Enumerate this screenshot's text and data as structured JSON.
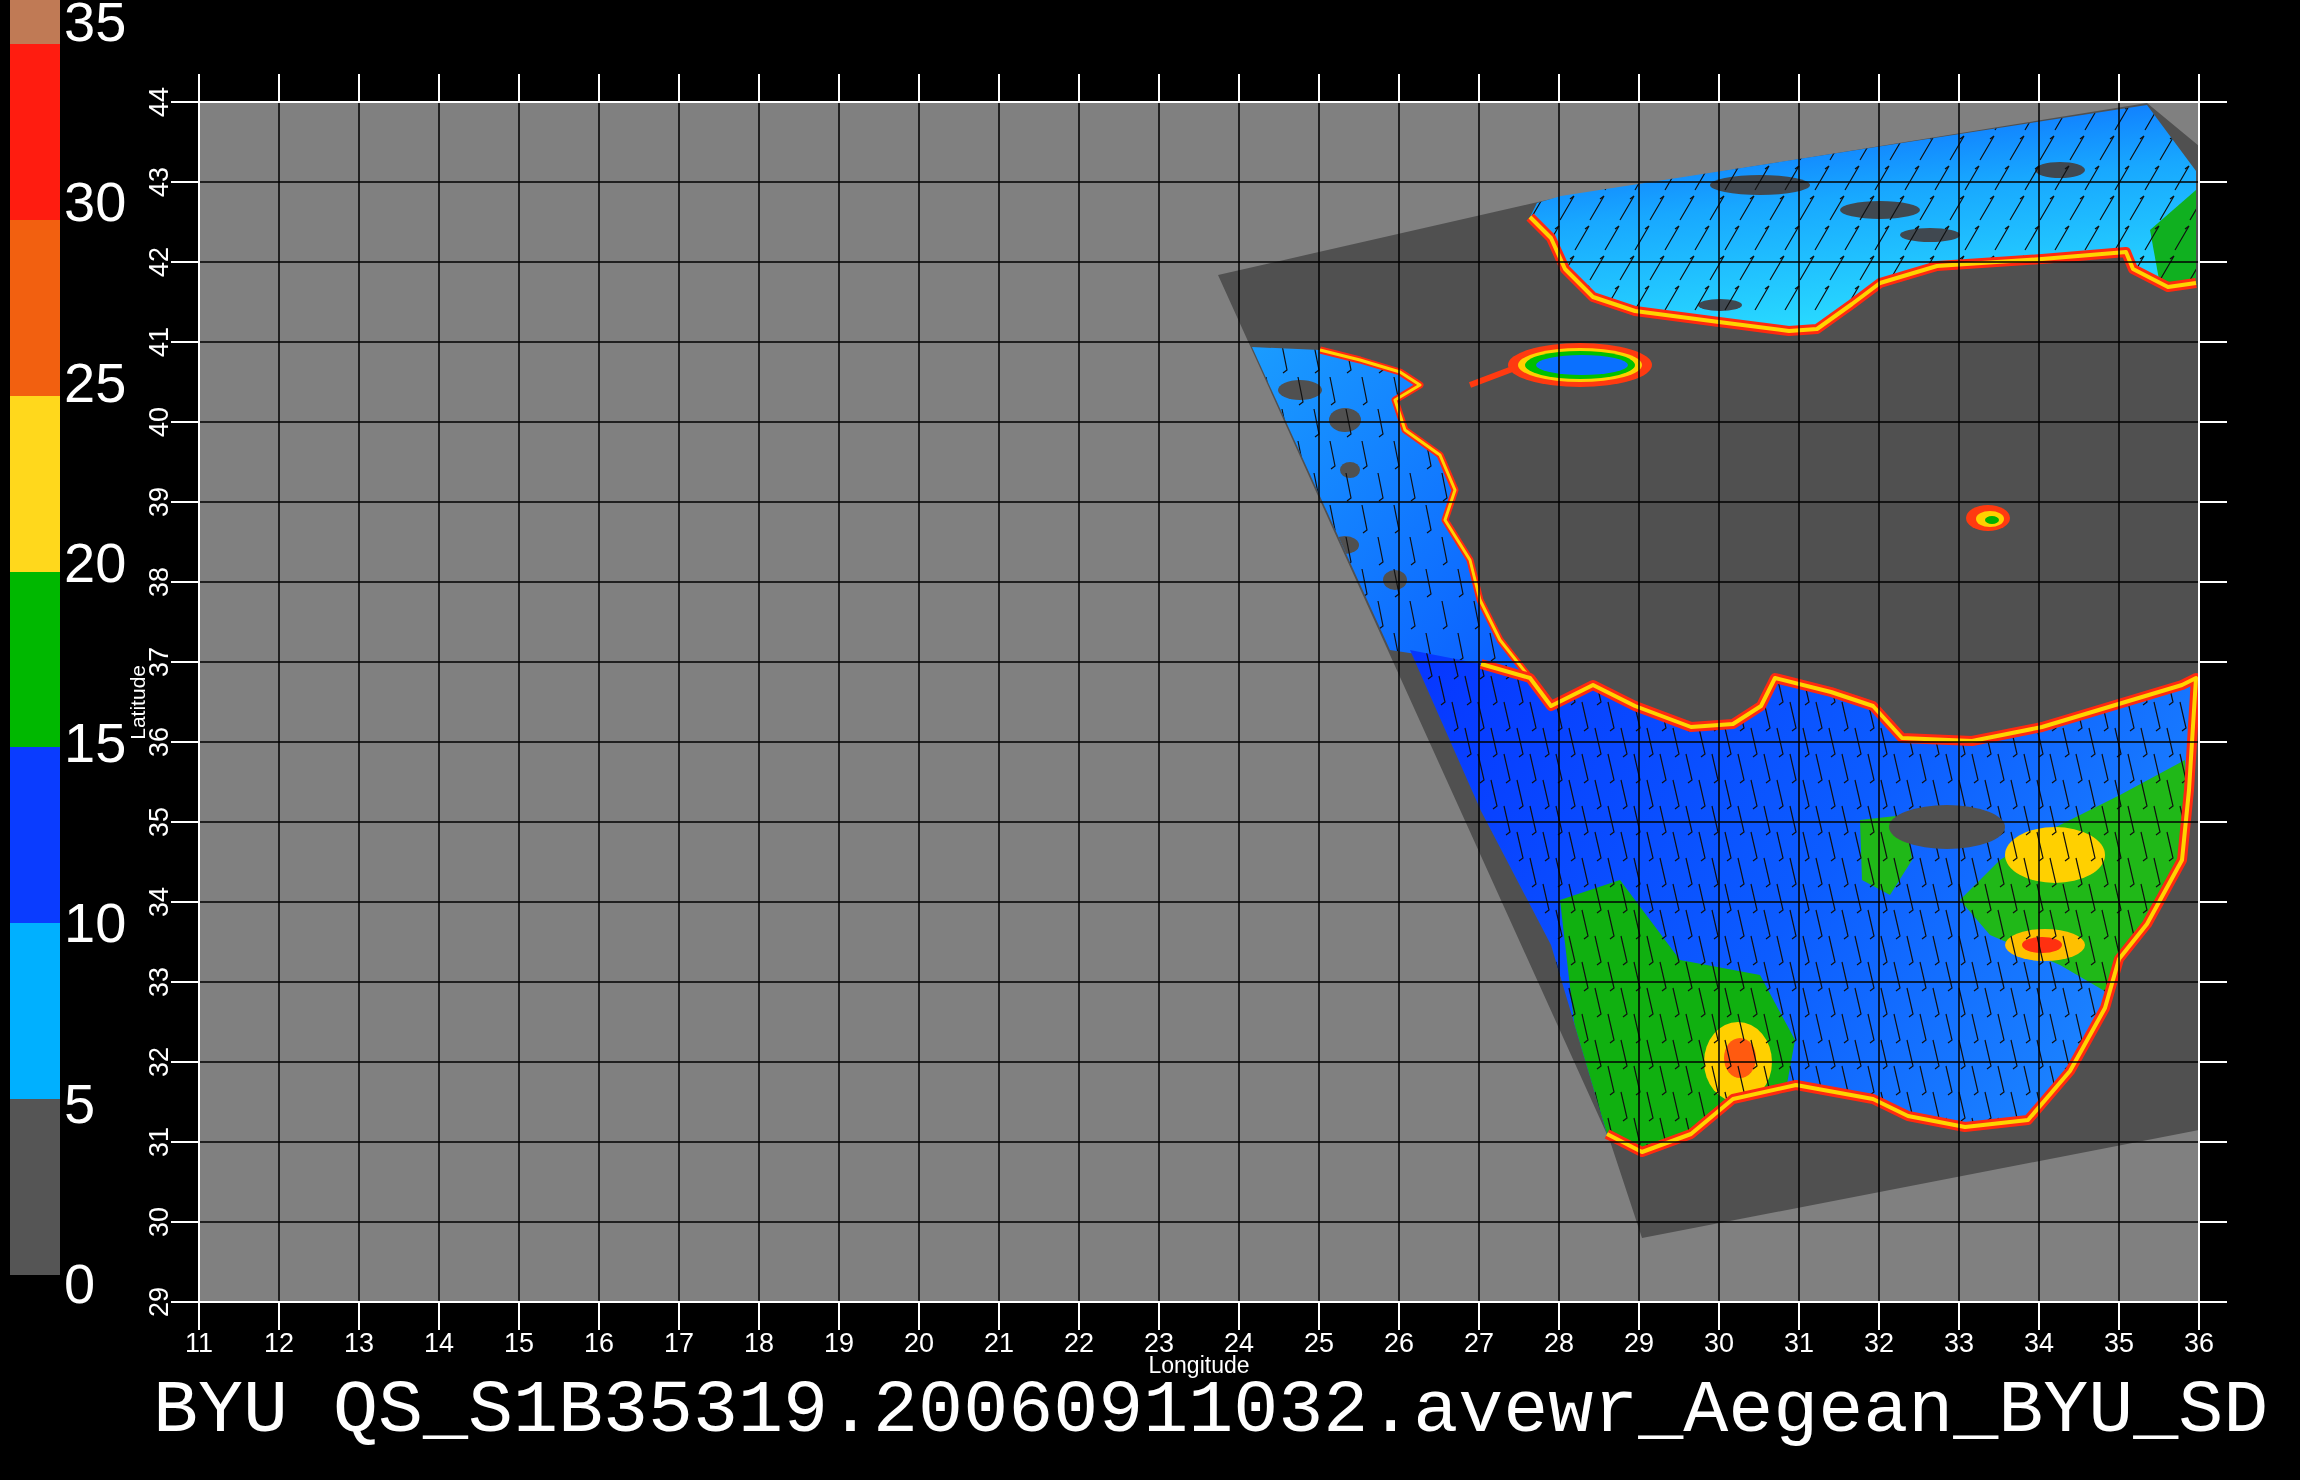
{
  "colorbar": {
    "segments": [
      {
        "color": "#c07a55"
      },
      {
        "color": "#ff1c10"
      },
      {
        "color": "#f26010"
      },
      {
        "color": "#ffd81c"
      },
      {
        "color": "#00b800"
      },
      {
        "color": "#0a3cff"
      },
      {
        "color": "#00b0ff"
      },
      {
        "color": "#555555"
      }
    ],
    "labels": [
      "35",
      "30",
      "25",
      "20",
      "15",
      "10",
      "5",
      "0"
    ]
  },
  "plot": {
    "ylabel": "Latitude",
    "yticks": [
      "44",
      "43",
      "42",
      "41",
      "40",
      "39",
      "38",
      "37",
      "36",
      "35",
      "34",
      "33",
      "32",
      "31",
      "30",
      "29"
    ],
    "xlabel": "Longitude",
    "xticks": [
      "11",
      "12",
      "13",
      "14",
      "15",
      "16",
      "17",
      "18",
      "19",
      "20",
      "21",
      "22",
      "23",
      "24",
      "25",
      "26",
      "27",
      "28",
      "29",
      "30",
      "31",
      "32",
      "33",
      "34",
      "35",
      "36"
    ]
  },
  "title": "BYU QS_S1B35319.20060911032.avewr_Aegean_BYU_SD"
}
